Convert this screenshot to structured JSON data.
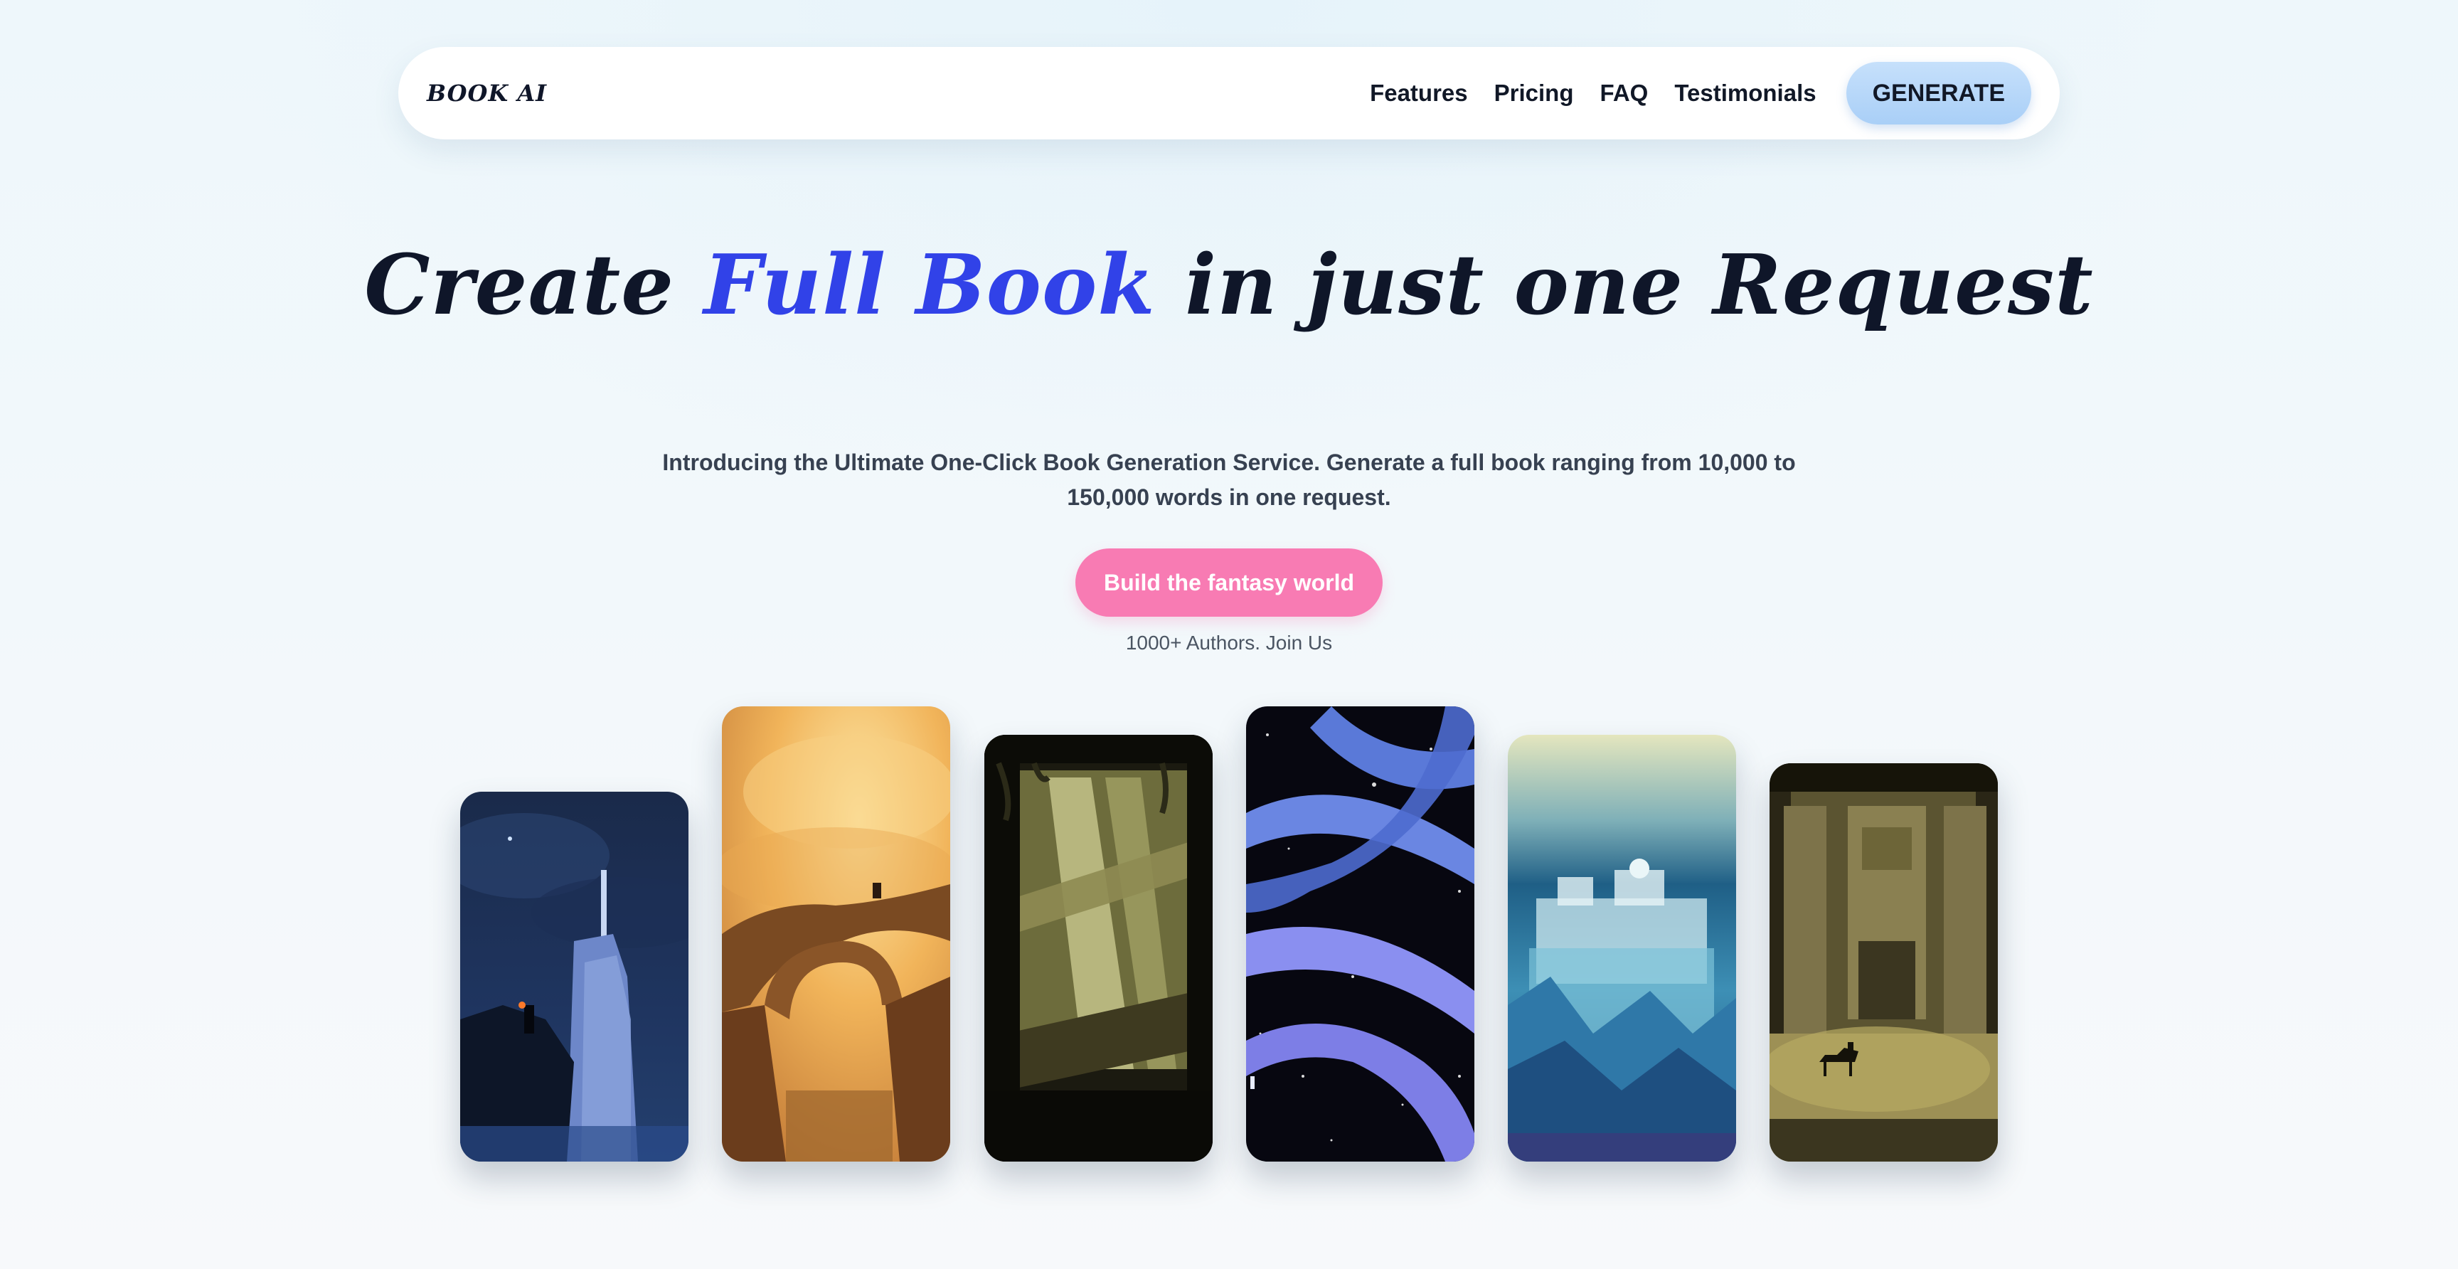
{
  "navbar": {
    "logo": "BOOK AI",
    "links": [
      "Features",
      "Pricing",
      "FAQ",
      "Testimonials"
    ],
    "cta_label": "GENERATE"
  },
  "hero": {
    "title_part1": "Create ",
    "title_highlight": "Full Book",
    "title_part2": " in just one Request",
    "subtitle": "Introducing the Ultimate One-Click Book Generation Service. Generate a full book ranging from 10,000 to 150,000 words in one request.",
    "cta_label": "Build the fantasy world",
    "social_proof": "1000+ Authors. Join Us"
  },
  "colors": {
    "accent": "#3142e8",
    "cta_pink": "#f87bb3",
    "generate_blue": "#a9cff7",
    "text_dark": "#0f1629"
  }
}
